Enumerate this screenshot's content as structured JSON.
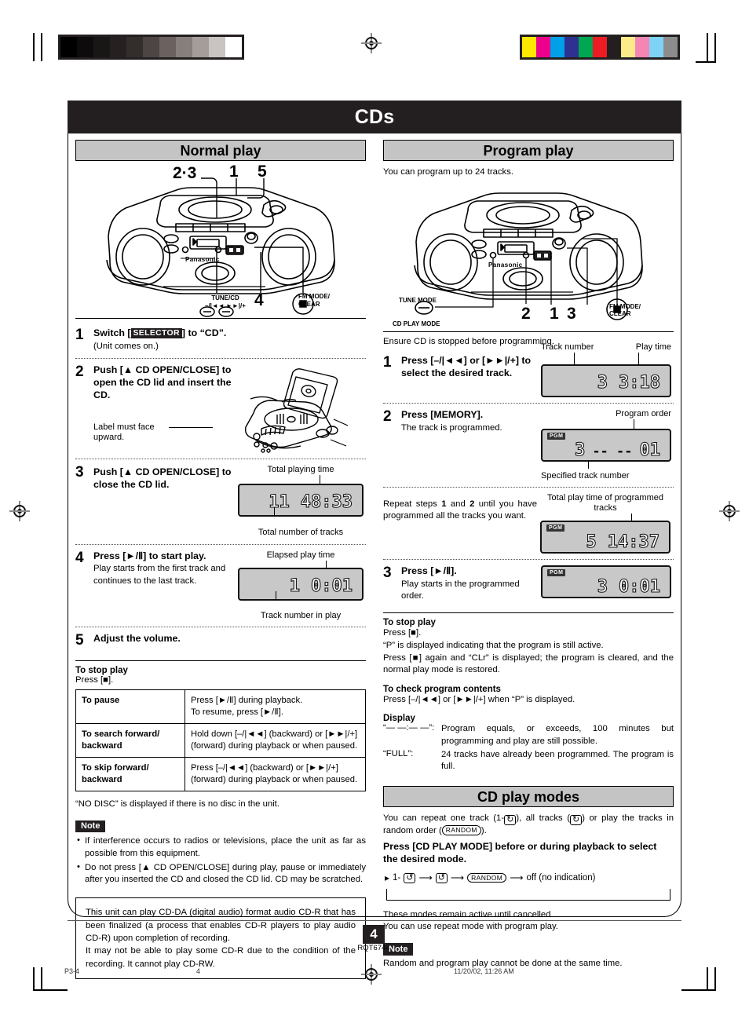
{
  "doc": {
    "title": "CDs",
    "page_number": "4",
    "doc_code": "RQT6744",
    "footer_left": "P3-4",
    "footer_page": "4",
    "footer_timestamp": "11/20/02, 11:26 AM"
  },
  "marks": {
    "gray_steps": [
      "#000000",
      "#0d0b0b",
      "#191616",
      "#262120",
      "#332d2c",
      "#4d4543",
      "#6b625f",
      "#877f7c",
      "#a49d9a",
      "#c9c4c1",
      "#ffffff"
    ],
    "color_steps": [
      "#ffe800",
      "#ec008c",
      "#00a0e9",
      "#2e3192",
      "#00a651",
      "#ed1c24",
      "#231f20",
      "#fdeb8a",
      "#f585b4",
      "#7cd3f5",
      "#8c8c8c"
    ]
  },
  "normal": {
    "heading": "Normal play",
    "diagram_labels": {
      "l23": "2·3",
      "l1": "1",
      "l5": "5",
      "l4": "4",
      "tune_cd": "TUNE/CD",
      "tune_cd_sub": "–/|◄◄   ►►|/+",
      "fm_mode": "FM MODE/",
      "fm_clear": "CLEAR",
      "brand": "Panasonic"
    },
    "steps": [
      {
        "num": "1",
        "head_pre": "Switch [",
        "head_kbd": "SELECTOR",
        "head_post": "] to “CD”.",
        "sub": "(Unit comes on.)"
      },
      {
        "num": "2",
        "head": "Push [▲ CD OPEN/CLOSE] to open the CD lid and insert the CD.",
        "figure_caption": "Label must face upward."
      },
      {
        "num": "3",
        "head": "Push [▲ CD OPEN/CLOSE] to close the CD lid.",
        "lcd_top_label": "Total playing time",
        "lcd_bottom_label": "Total number of tracks",
        "lcd_track": "11",
        "lcd_time": "48:33"
      },
      {
        "num": "4",
        "head": "Press [►/Ⅱ] to start play.",
        "sub": "Play starts from the first track and continues to the last track.",
        "lcd_top_label": "Elapsed play time",
        "lcd_bottom_label": "Track number in play",
        "lcd_track": "1",
        "lcd_time": "0:01"
      },
      {
        "num": "5",
        "head": "Adjust the volume."
      }
    ],
    "stop": {
      "title": "To stop play",
      "line": "Press [■]."
    },
    "ops_table": [
      {
        "k": "To pause",
        "v": "Press [►/Ⅱ] during playback.\nTo resume, press [►/Ⅱ]."
      },
      {
        "k": "To search forward/ backward",
        "v": "Hold down [–/|◄◄] (backward) or [►►|/+] (forward) during playback or when paused."
      },
      {
        "k": "To skip forward/ backward",
        "v": "Press [–/|◄◄] (backward) or [►►|/+] (forward) during playback or when paused."
      }
    ],
    "nodisc": "“NO DISC” is displayed if there is no disc in the unit.",
    "note_label": "Note",
    "notes": [
      "If interference occurs to radios or televisions, place the unit as far as possible from this equipment.",
      "Do not press [▲ CD OPEN/CLOSE] during play, pause or immediately after you inserted the CD and closed the CD lid. CD may be scratched."
    ],
    "boxnote": "This unit can play CD-DA (digital audio) format audio CD-R that has been finalized (a process that enables CD-R players to play audio CD-R) upon completion of recording.\nIt may not be able to play some CD-R due to the condition of the recording. It cannot play CD-RW."
  },
  "program": {
    "heading": "Program play",
    "intro": "You can program up to 24 tracks.",
    "diagram_labels": {
      "tune_mode": "TUNE MODE",
      "cd_play_mode": "CD PLAY MODE",
      "n2": "2",
      "n1": "1",
      "n3": "3",
      "fm_mode": "FM MODE/",
      "fm_clear": "CLEAR",
      "brand": "Panasonic"
    },
    "ensure": "Ensure CD is stopped before programming.",
    "steps": [
      {
        "num": "1",
        "head": "Press [–/|◄◄] or [►►|/+] to select the desired track.",
        "lcd_label_left": "Track number",
        "lcd_label_right": "Play time",
        "lcd_track": "3",
        "lcd_time": "3:18",
        "pgm": false
      },
      {
        "num": "2",
        "head": "Press [MEMORY].",
        "sub": "The track is programmed.",
        "lcd_label_top": "Program order",
        "lcd_label_bottom": "Specified track number",
        "lcd_track": "3",
        "lcd_dashes": "-- --",
        "lcd_time": "01",
        "pgm": true,
        "pgm_label": "PGM"
      }
    ],
    "repeat_note_pre": "Repeat steps ",
    "repeat_note_a": "1",
    "repeat_note_mid": " and ",
    "repeat_note_b": "2",
    "repeat_note_post": " until you have programmed all the tracks you want.",
    "repeat_lcd_label": "Total play time of programmed tracks",
    "repeat_lcd_track": "5",
    "repeat_lcd_time": "14:37",
    "repeat_lcd_pgm": "PGM",
    "step3": {
      "num": "3",
      "head": "Press [►/Ⅱ].",
      "sub": "Play starts in the programmed order.",
      "lcd_track": "3",
      "lcd_time": "0:01",
      "lcd_pgm": "PGM"
    },
    "stop": {
      "title": "To stop play",
      "lines": [
        "Press [■].",
        "“P” is displayed indicating that the program is still active.",
        "Press [■] again and “CLr” is displayed; the program is cleared, and the normal play mode is restored."
      ]
    },
    "check": {
      "title": "To check program contents",
      "line": "Press [–/|◄◄] or [►►|/+] when “P” is displayed."
    },
    "display": {
      "title": "Display",
      "rows": [
        {
          "k": "“— —:— —”:",
          "v": "Program equals, or exceeds, 100 minutes but programming and play are still possible."
        },
        {
          "k": "“FULL”:",
          "v": "24 tracks have already been programmed. The program is full."
        }
      ]
    }
  },
  "playmodes": {
    "heading": "CD play modes",
    "intro_a": "You can repeat one track (1-",
    "intro_b": "), all tracks (",
    "intro_c": ") or play the tracks in random order (",
    "intro_d": ").",
    "random_chip": "RANDOM",
    "bold_line": "Press [CD PLAY MODE] before or during playback to select the desired mode.",
    "flow": [
      "1-",
      "↺",
      "↺",
      "RANDOM",
      "off (no indication)"
    ],
    "flow_off_label": "off (no indication)",
    "tail_a": "These modes remain active until cancelled.",
    "tail_b": "You can use repeat mode with program play.",
    "note_label": "Note",
    "note": "Random and program play cannot be done at the same time."
  }
}
